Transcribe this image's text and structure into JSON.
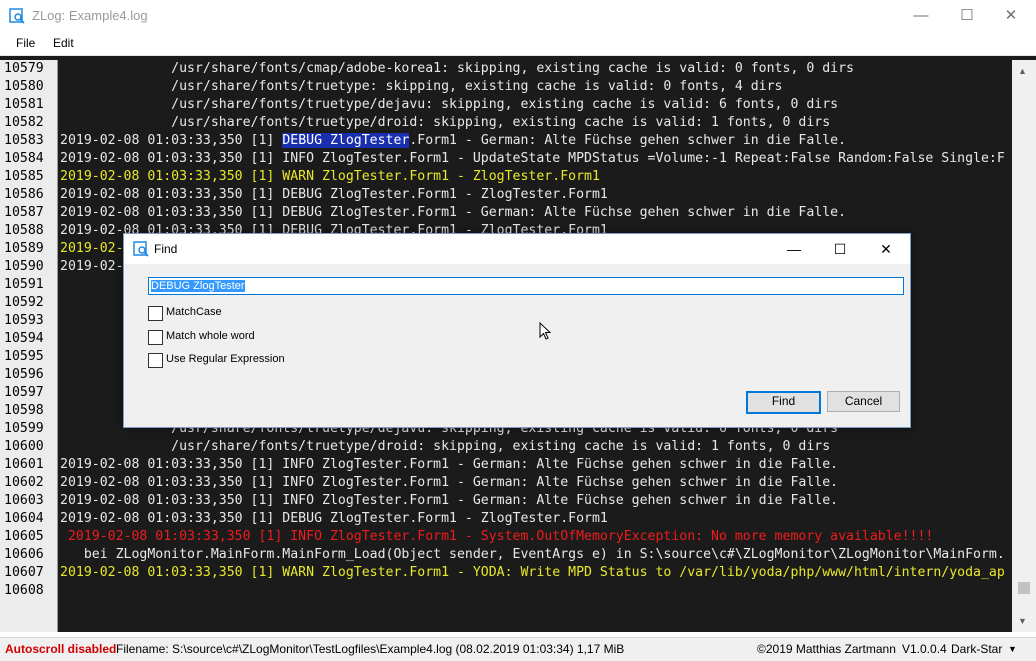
{
  "window": {
    "title": "ZLog: Example4.log",
    "minimize": "—",
    "maximize": "☐",
    "close": "✕"
  },
  "menu": [
    "File",
    "Edit"
  ],
  "colors": {
    "log_background": "#1b1b1b",
    "info": "#e8e8e8",
    "warn": "#e8e82a",
    "error": "#ee1c1c",
    "highlight": "#1a2fb0"
  },
  "log_lines": [
    {
      "n": "10579",
      "c": "white",
      "t": "              /usr/share/fonts/cmap/adobe-korea1: skipping, existing cache is valid: 0 fonts, 0 dirs"
    },
    {
      "n": "10580",
      "c": "white",
      "t": "              /usr/share/fonts/truetype: skipping, existing cache is valid: 0 fonts, 4 dirs"
    },
    {
      "n": "10581",
      "c": "white",
      "t": "              /usr/share/fonts/truetype/dejavu: skipping, existing cache is valid: 6 fonts, 0 dirs"
    },
    {
      "n": "10582",
      "c": "white",
      "t": "              /usr/share/fonts/truetype/droid: skipping, existing cache is valid: 1 fonts, 0 dirs"
    },
    {
      "n": "10583",
      "c": "white",
      "pre": "2019-02-08 01:03:33,350 [1] ",
      "hl": "DEBUG ZlogTester",
      "t": ".Form1 - German: Alte Füchse gehen schwer in die Falle."
    },
    {
      "n": "10584",
      "c": "white",
      "t": "2019-02-08 01:03:33,350 [1] INFO ZlogTester.Form1 - UpdateState MPDStatus =Volume:-1 Repeat:False Random:False Single:F"
    },
    {
      "n": "10585",
      "c": "yellow",
      "t": "2019-02-08 01:03:33,350 [1] WARN ZlogTester.Form1 - ZlogTester.Form1"
    },
    {
      "n": "10586",
      "c": "white",
      "t": "2019-02-08 01:03:33,350 [1] DEBUG ZlogTester.Form1 - ZlogTester.Form1"
    },
    {
      "n": "10587",
      "c": "white",
      "t": "2019-02-08 01:03:33,350 [1] DEBUG ZlogTester.Form1 - German: Alte Füchse gehen schwer in die Falle."
    },
    {
      "n": "10588",
      "c": "white",
      "t": "2019-02-08 01:03:33,350 [1] DEBUG ZlogTester.Form1 - ZlogTester.Form1"
    },
    {
      "n": "10589",
      "c": "yellow",
      "t": "2019-02-"
    },
    {
      "n": "10590",
      "c": "white",
      "t": "2019-02-                                                                                      on=8.24.0 x-p"
    },
    {
      "n": "10591",
      "c": "white",
      "t": ""
    },
    {
      "n": "10592",
      "c": "white",
      "t": ""
    },
    {
      "n": "10593",
      "c": "white",
      "t": ""
    },
    {
      "n": "10594",
      "c": "white",
      "t": ""
    },
    {
      "n": "10595",
      "c": "white",
      "t": ""
    },
    {
      "n": "10596",
      "c": "white",
      "t": ""
    },
    {
      "n": "10597",
      "c": "white",
      "t": ""
    },
    {
      "n": "10598",
      "c": "white",
      "t": ""
    },
    {
      "n": "10599",
      "c": "white",
      "t": "              /usr/share/fonts/truetype/dejavu: skipping, existing cache is valid: 6 fonts, 0 dirs"
    },
    {
      "n": "10600",
      "c": "white",
      "t": "              /usr/share/fonts/truetype/droid: skipping, existing cache is valid: 1 fonts, 0 dirs"
    },
    {
      "n": "10601",
      "c": "white",
      "t": "2019-02-08 01:03:33,350 [1] INFO ZlogTester.Form1 - German: Alte Füchse gehen schwer in die Falle."
    },
    {
      "n": "10602",
      "c": "white",
      "t": "2019-02-08 01:03:33,350 [1] INFO ZlogTester.Form1 - German: Alte Füchse gehen schwer in die Falle."
    },
    {
      "n": "10603",
      "c": "white",
      "t": "2019-02-08 01:03:33,350 [1] INFO ZlogTester.Form1 - German: Alte Füchse gehen schwer in die Falle."
    },
    {
      "n": "10604",
      "c": "white",
      "t": "2019-02-08 01:03:33,350 [1] DEBUG ZlogTester.Form1 - ZlogTester.Form1"
    },
    {
      "n": "10605",
      "c": "red",
      "t": " 2019-02-08 01:03:33,350 [1] INFO ZlogTester.Form1 - System.OutOfMemoryException: No more memory available!!!!"
    },
    {
      "n": "10606",
      "c": "white",
      "t": "   bei ZLogMonitor.MainForm.MainForm_Load(Object sender, EventArgs e) in S:\\source\\c#\\ZLogMonitor\\ZLogMonitor\\MainForm."
    },
    {
      "n": "10607",
      "c": "yellow",
      "t": "2019-02-08 01:03:33,350 [1] WARN ZlogTester.Form1 - YODA: Write MPD Status to /var/lib/yoda/php/www/html/intern/yoda_ap"
    },
    {
      "n": "10608",
      "c": "white",
      "t": ""
    }
  ],
  "scrollbar": {
    "up": "▲",
    "down": "▼"
  },
  "find_dialog": {
    "title": "Find",
    "minimize": "—",
    "maximize": "☐",
    "close": "✕",
    "search_value": "DEBUG ZlogTester",
    "options": [
      "MatchCase",
      "Match whole word",
      "Use Regular Expression"
    ],
    "find_label": "Find",
    "cancel_label": "Cancel"
  },
  "status": {
    "autoscroll": "Autoscroll disabled",
    "filename": "Filename: S:\\source\\c#\\ZLogMonitor\\TestLogfiles\\Example4.log (08.02.2019 01:03:34) 1,17 MiB",
    "copyright": "©2019 Matthias Zartmann",
    "version": "V1.0.0.4",
    "theme": "Dark-Star",
    "theme_arrow": "▼"
  }
}
